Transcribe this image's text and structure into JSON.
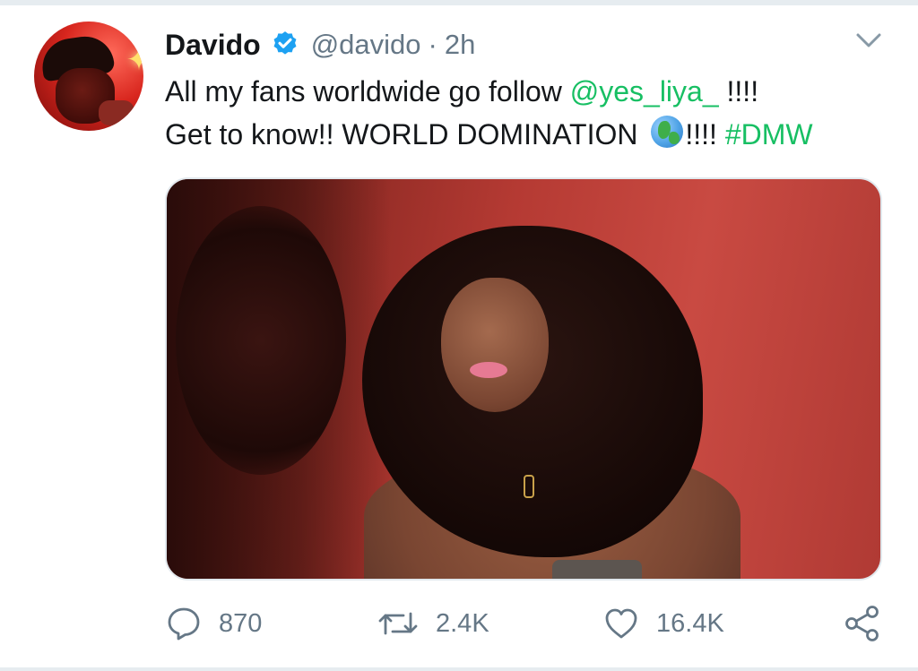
{
  "tweet": {
    "author": {
      "display_name": "Davido",
      "handle": "@davido",
      "verified": true
    },
    "separator": "·",
    "timestamp": "2h",
    "text": {
      "line1_prefix": "All my fans worldwide go follow ",
      "mention": "@yes_liya_",
      "line1_suffix": " !!!!",
      "line2_prefix": "Get to know!! WORLD DOMINATION ",
      "line2_suffix": "!!!! ",
      "hashtag": "#DMW"
    },
    "media": {
      "type": "photo"
    },
    "actions": {
      "replies": "870",
      "retweets": "2.4K",
      "likes": "16.4K"
    }
  },
  "icons": {
    "verified": "verified-badge-icon",
    "menu": "chevron-down-icon",
    "reply": "speech-bubble-icon",
    "retweet": "retweet-icon",
    "like": "heart-icon",
    "share": "share-icon",
    "emoji": "globe-icon"
  },
  "colors": {
    "link": "#17bf63",
    "secondary_text": "#657786",
    "verified": "#1da1f2",
    "text": "#14171a"
  }
}
